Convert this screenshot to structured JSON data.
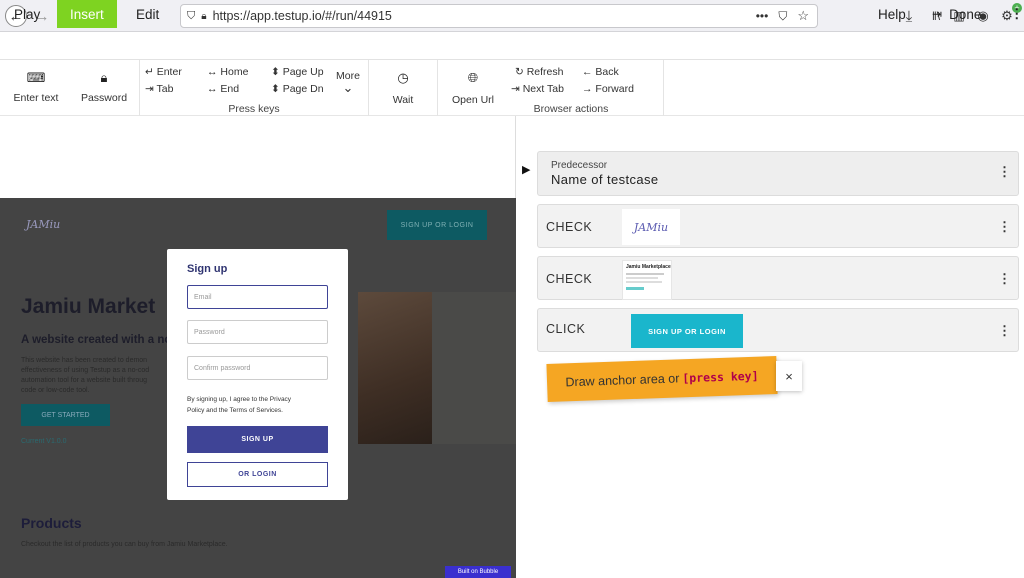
{
  "browser": {
    "url": "https://app.testup.io/#/run/44915",
    "icons": [
      "back-icon",
      "forward-icon",
      "reload-icon",
      "home-icon",
      "shield-icon",
      "lock-icon",
      "more-icon",
      "pocket-icon",
      "star-icon",
      "download-icon",
      "library-icon",
      "sidebar-icon",
      "account-icon",
      "extension-icon"
    ]
  },
  "menu": {
    "play": "Play",
    "insert": "Insert",
    "edit": "Edit",
    "help": "Help",
    "done": "Done"
  },
  "toolbar": {
    "enter_text": "Enter text",
    "password": "Password",
    "key_enter": "↵ Enter",
    "key_tab": "⇥ Tab",
    "key_home": "↔ Home",
    "key_end": "↔ End",
    "key_pageup": "⬍ Page Up",
    "key_pagedn": "⬍ Page Dn",
    "more": "More",
    "press_keys": "Press keys",
    "wait": "Wait",
    "open_url": "Open Url",
    "refresh": "↻ Refresh",
    "next_tab": "⇥ Next Tab",
    "back": "← Back",
    "forward": "→ Forward",
    "browser_actions": "Browser actions"
  },
  "preview": {
    "logo": "JAMiu",
    "nav_button": "SIGN UP OR LOGIN",
    "hero_title": "Jamiu Market",
    "hero_sub": "A website created with a no-co",
    "hero_body": [
      "This website has been created to demon",
      "effectiveness of using Testup as a no-cod",
      "automation tool for a website built throug",
      "code or low-code tool."
    ],
    "get_started": "GET STARTED",
    "version": "Current V1.0.0",
    "products_title": "Products",
    "products_body": "Checkout the list of products you can buy from Jamiu Marketplace.",
    "built_on": "Built on Bubble",
    "modal": {
      "title": "Sign up",
      "email_ph": "Email",
      "password_ph": "Password",
      "confirm_ph": "Confirm password",
      "terms": [
        "By signing up, I agree to the Privacy",
        "Policy and the Terms of Services."
      ],
      "signup_btn": "SIGN UP",
      "login_btn": "OR LOGIN"
    }
  },
  "steps": {
    "predecessor_label": "Predecessor",
    "predecessor_name": "Name of testcase",
    "check1": "CHECK",
    "check1_img": "JAMiu",
    "check2": "CHECK",
    "check2_img_title": "Jamiu Marketplace",
    "click": "CLICK",
    "click_btn": "SIGN UP OR LOGIN"
  },
  "tooltip": {
    "text": "Draw anchor area or ",
    "key": "[press key]",
    "close": "×"
  },
  "colors": {
    "insert_tab": "#7ed321",
    "teal": "#00b4c8",
    "modal_btn": "#3f4496",
    "tooltip": "#f5a623",
    "key_text": "#b0004a"
  }
}
